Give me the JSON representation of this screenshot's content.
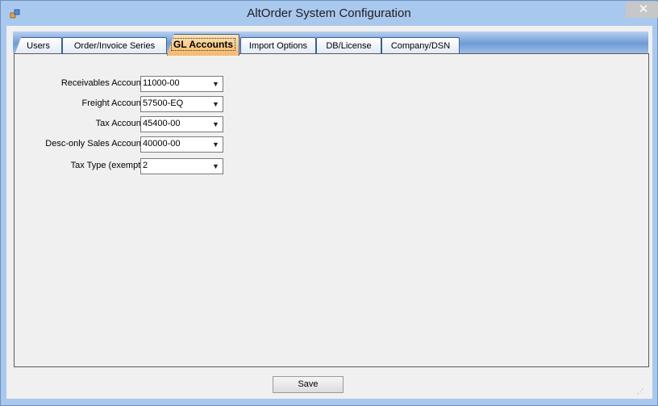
{
  "window": {
    "title": "AltOrder System Configuration",
    "close_glyph": "✕"
  },
  "tabs": [
    {
      "label": "Users"
    },
    {
      "label": "Order/Invoice Series"
    },
    {
      "label": "GL Accounts"
    },
    {
      "label": "Import Options"
    },
    {
      "label": "DB/License"
    },
    {
      "label": "Company/DSN"
    }
  ],
  "active_tab": "GL Accounts",
  "fields": [
    {
      "label": "Receivables Account:",
      "value": "11000-00"
    },
    {
      "label": "Freight Account:",
      "value": "57500-EQ"
    },
    {
      "label": "Tax Account:",
      "value": "45400-00"
    },
    {
      "label": "Desc-only Sales Account:",
      "value": "40000-00"
    },
    {
      "label": "Tax Type (exempt):",
      "value": "2"
    }
  ],
  "footer": {
    "save_label": "Save"
  },
  "icons": {
    "app": "app-icon",
    "dropdown": "chevron-down-icon",
    "close": "close-icon"
  }
}
